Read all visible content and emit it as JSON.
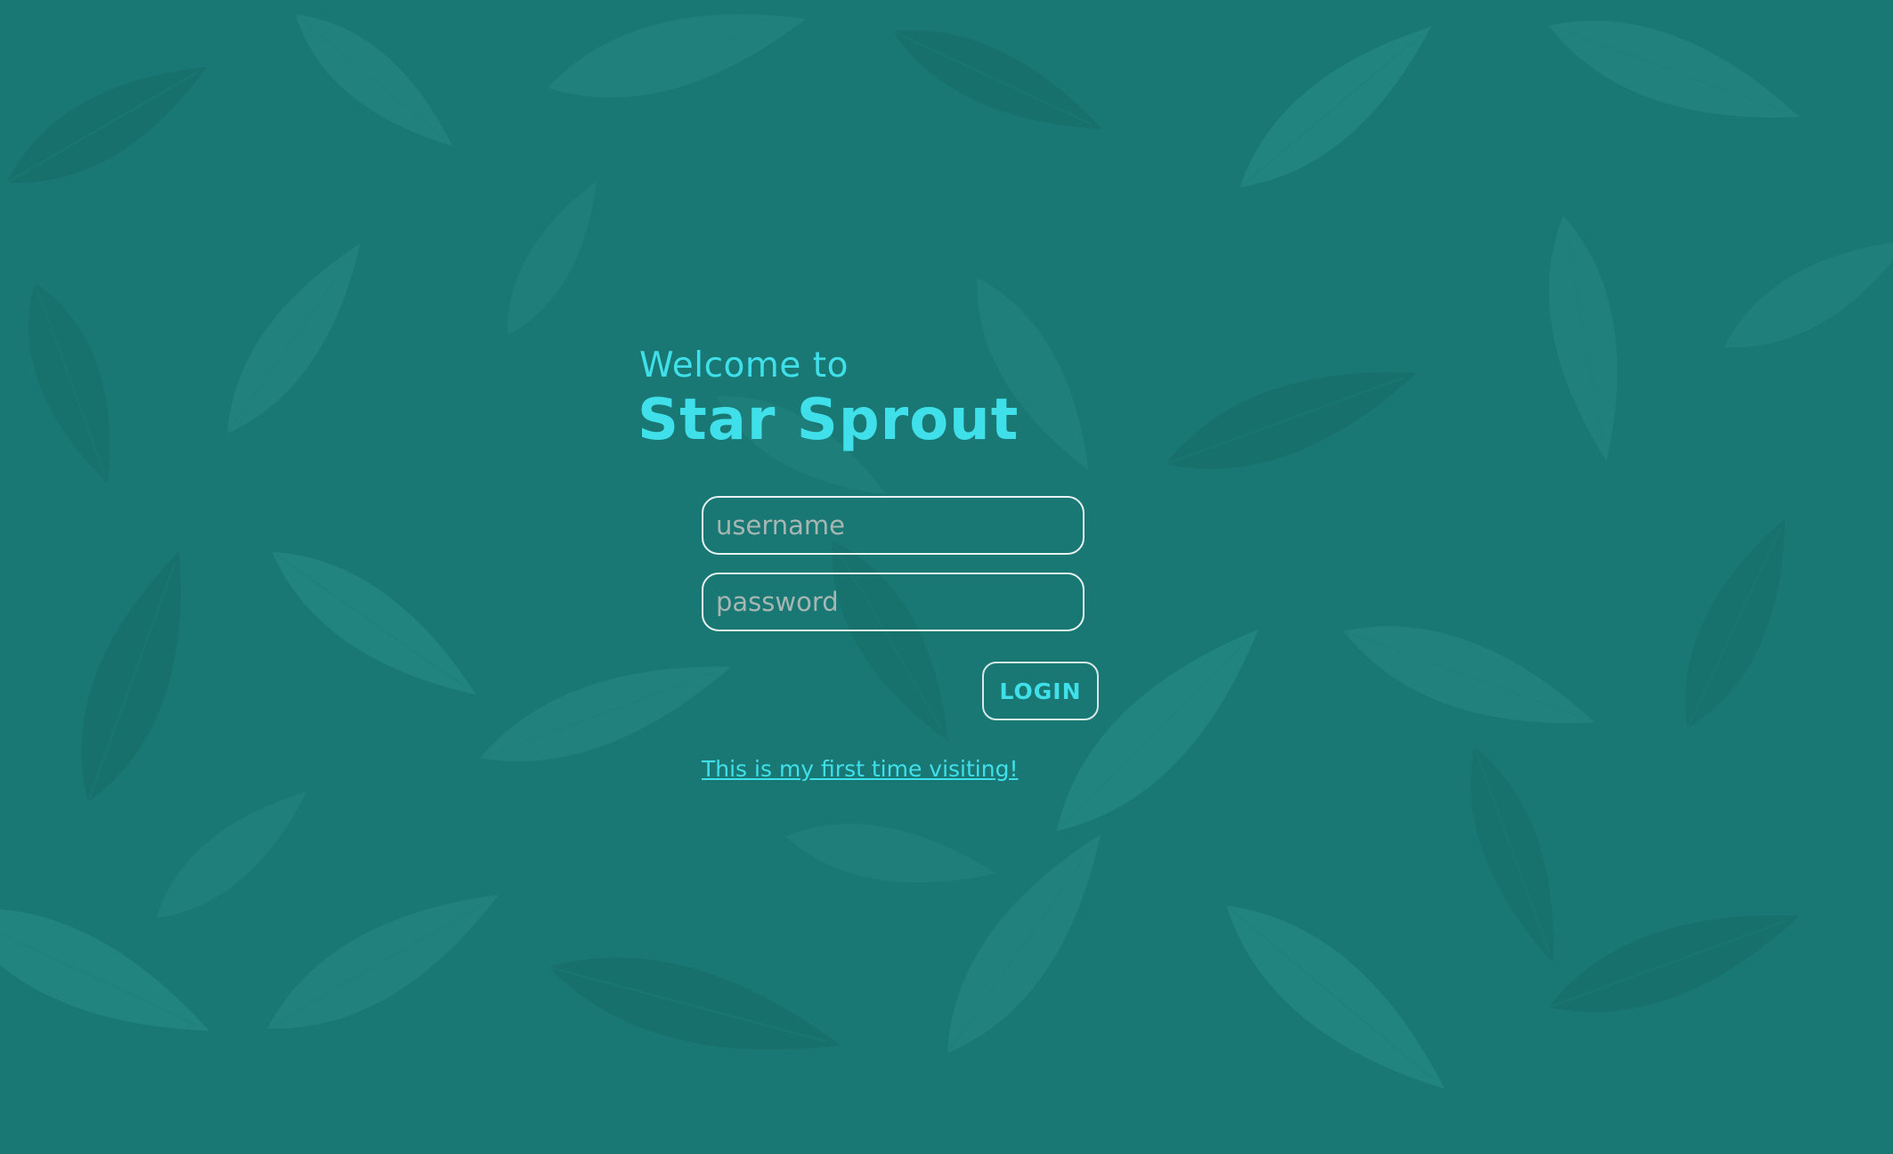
{
  "welcome": {
    "line1": "Welcome to",
    "app_name": "Star Sprout"
  },
  "form": {
    "username_placeholder": "username",
    "password_placeholder": "password",
    "login_label": "LOGIN",
    "first_visit_link": "This is my first time visiting!"
  },
  "colors": {
    "background": "#1a7874",
    "leaf_light": "#2a8f89",
    "accent": "#3fe0ea",
    "field_border": "#e7f3f2",
    "placeholder": "#a6b6b3"
  }
}
